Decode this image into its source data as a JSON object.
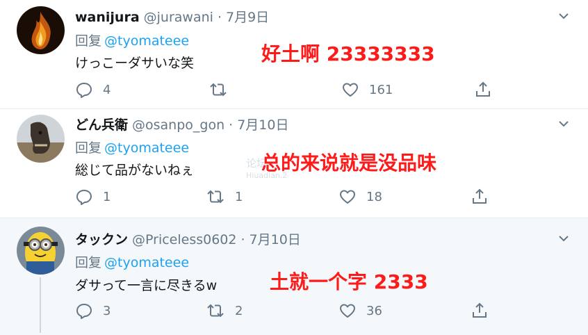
{
  "tweets": [
    {
      "name": "wanijura",
      "handle": "@jurawani",
      "separator": "·",
      "date": "7月9日",
      "reply_prefix": "回复",
      "mention": "@tyomateee",
      "text": "けっこーダサいな笑",
      "caption": "好土啊 23333333",
      "replies": "4",
      "retweets": "",
      "likes": "161",
      "avatar_icon": "avatar-flame"
    },
    {
      "name": "どん兵衛",
      "handle": "@osanpo_gon",
      "separator": "·",
      "date": "7月10日",
      "reply_prefix": "回复",
      "mention": "@tyomateee",
      "text": "総じて品がないねぇ",
      "caption": "总的来说就是没品味",
      "replies": "1",
      "retweets": "1",
      "likes": "18",
      "avatar_icon": "avatar-horse"
    },
    {
      "name": "タックン",
      "handle": "@Priceless0602",
      "separator": "·",
      "date": "7月10日",
      "reply_prefix": "回复",
      "mention": "@tyomateee",
      "text": "ダサって一言に尽きるw",
      "caption": "土就一个字 2333",
      "replies": "3",
      "retweets": "2",
      "likes": "36",
      "avatar_icon": "avatar-minion"
    }
  ],
  "watermark": {
    "line1": "论坛",
    "line2": "Hiuadian.2"
  },
  "colors": {
    "link": "#1da1f2",
    "muted": "#657786",
    "caption": "#ff1a1a",
    "highlight_bg": "#f5f8fa"
  }
}
